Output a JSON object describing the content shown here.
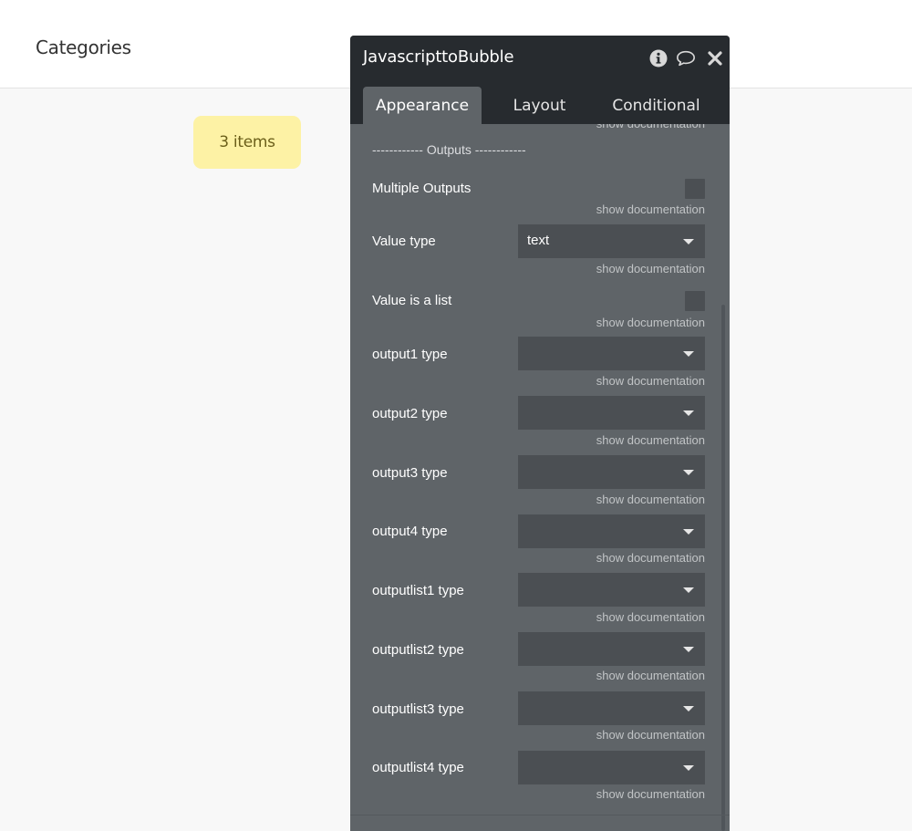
{
  "page": {
    "title": "Categories"
  },
  "badge": {
    "label": "3 items"
  },
  "panel": {
    "title": "JavascripttoBubble",
    "icons": [
      "info-icon",
      "comment-icon",
      "close-icon"
    ],
    "tabs": [
      {
        "label": "Appearance",
        "active": true
      },
      {
        "label": "Layout",
        "active": false
      },
      {
        "label": "Conditional",
        "active": false
      }
    ],
    "doc_link": "show documentation",
    "section_label": "------------ Outputs ------------",
    "rows": {
      "multiple_outputs": {
        "label": "Multiple Outputs",
        "checked": false
      },
      "value_type": {
        "label": "Value type",
        "value": "text"
      },
      "value_is_list": {
        "label": "Value is a list",
        "checked": false
      },
      "output1": {
        "label": "output1 type",
        "value": ""
      },
      "output2": {
        "label": "output2 type",
        "value": ""
      },
      "output3": {
        "label": "output3 type",
        "value": ""
      },
      "output4": {
        "label": "output4 type",
        "value": ""
      },
      "outputlist1": {
        "label": "outputlist1 type",
        "value": ""
      },
      "outputlist2": {
        "label": "outputlist2 type",
        "value": ""
      },
      "outputlist3": {
        "label": "outputlist3 type",
        "value": ""
      },
      "outputlist4": {
        "label": "outputlist4 type",
        "value": ""
      }
    }
  },
  "colors": {
    "panel_bg": "#5f6468",
    "panel_header": "#272b2f",
    "input_bg": "#4b4f53",
    "badge_bg": "#fdf2a5"
  }
}
